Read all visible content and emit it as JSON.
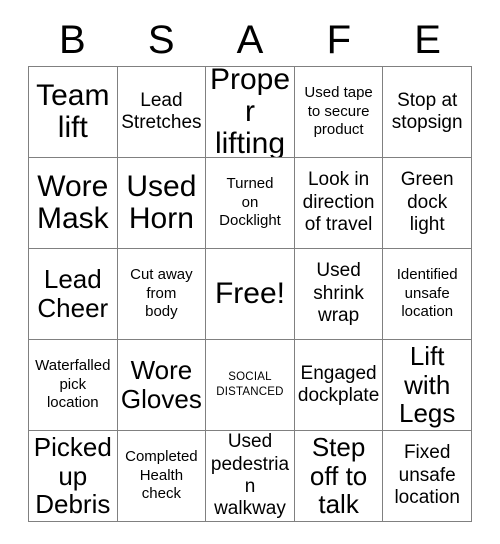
{
  "card": {
    "title_letters": [
      "B",
      "S",
      "A",
      "F",
      "E"
    ],
    "columns": 5,
    "rows": 5,
    "border_color": "#808080",
    "background_color": "#ffffff",
    "text_color": "#000000",
    "cells": [
      [
        {
          "text": "Team\nlift",
          "size": "xl"
        },
        {
          "text": "Lead\nStretches",
          "size": "md"
        },
        {
          "text": "Proper\nlifting",
          "size": "xl"
        },
        {
          "text": "Used tape\nto secure\nproduct",
          "size": "sm"
        },
        {
          "text": "Stop at\nstopsign",
          "size": "md"
        }
      ],
      [
        {
          "text": "Wore\nMask",
          "size": "xl"
        },
        {
          "text": "Used\nHorn",
          "size": "xl"
        },
        {
          "text": "Turned\non\nDocklight",
          "size": "sm"
        },
        {
          "text": "Look in\ndirection\nof travel",
          "size": "md"
        },
        {
          "text": "Green\ndock\nlight",
          "size": "md"
        }
      ],
      [
        {
          "text": "Lead\nCheer",
          "size": "lg"
        },
        {
          "text": "Cut away\nfrom\nbody",
          "size": "sm"
        },
        {
          "text": "Free!",
          "size": "xl"
        },
        {
          "text": "Used\nshrink\nwrap",
          "size": "md"
        },
        {
          "text": "Identified\nunsafe\nlocation",
          "size": "sm"
        }
      ],
      [
        {
          "text": "Waterfalled\npick\nlocation",
          "size": "sm"
        },
        {
          "text": "Wore\nGloves",
          "size": "lg"
        },
        {
          "text": "SOCIAL\nDISTANCED",
          "size": "xs"
        },
        {
          "text": "Engaged\ndockplate",
          "size": "md"
        },
        {
          "text": "Lift\nwith\nLegs",
          "size": "lg"
        }
      ],
      [
        {
          "text": "Picked\nup\nDebris",
          "size": "lg"
        },
        {
          "text": "Completed\nHealth\ncheck",
          "size": "sm"
        },
        {
          "text": "Used\npedestrian\nwalkway",
          "size": "md"
        },
        {
          "text": "Step\noff to\ntalk",
          "size": "lg"
        },
        {
          "text": "Fixed\nunsafe\nlocation",
          "size": "md"
        }
      ]
    ]
  }
}
